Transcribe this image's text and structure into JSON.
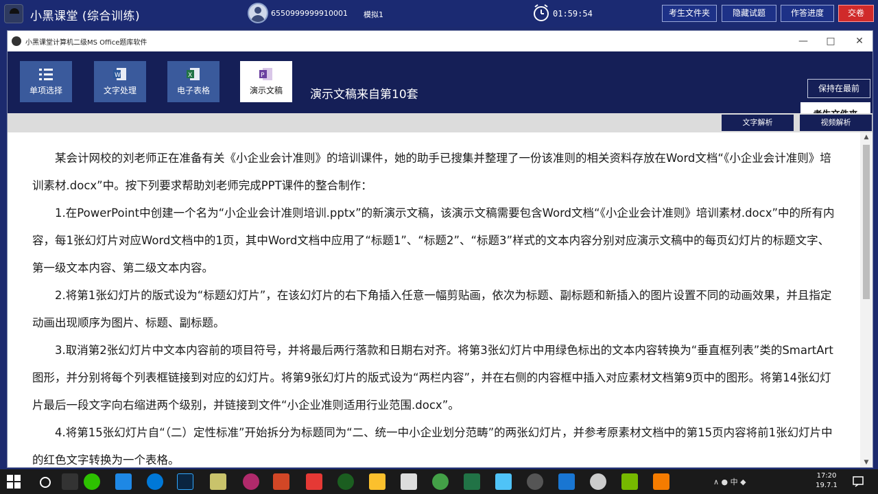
{
  "outer": {
    "app_title": "小黑课堂 (综合训练)",
    "user_id": "6550999999910001",
    "user_name": "模拟1",
    "timer": "01:59:54",
    "buttons": [
      "考生文件夹",
      "隐藏试题",
      "作答进度",
      "交卷"
    ]
  },
  "dialog": {
    "title": "小黑课堂计算机二级MS Office题库软件",
    "window_controls": [
      "—",
      "□",
      "✕"
    ],
    "tools": [
      {
        "label": "单项选择",
        "icon": "list-icon"
      },
      {
        "label": "文字处理",
        "icon": "word-icon"
      },
      {
        "label": "电子表格",
        "icon": "excel-icon"
      },
      {
        "label": "演示文稿",
        "icon": "powerpoint-icon"
      }
    ],
    "source": "演示文稿来自第10套",
    "keep_front": "保持在最前",
    "exam_folder": "考生文件夹",
    "sub_buttons": [
      "文字解析",
      "视频解析"
    ]
  },
  "content": {
    "paragraphs": [
      "某会计网校的刘老师正在准备有关《小企业会计准则》的培训课件，她的助手已搜集并整理了一份该准则的相关资料存放在Word文档“《小企业会计准则》培训素材.docx”中。按下列要求帮助刘老师完成PPT课件的整合制作：",
      "1.在PowerPoint中创建一个名为“小企业会计准则培训.pptx”的新演示文稿，该演示文稿需要包含Word文档“《小企业会计准则》培训素材.docx”中的所有内容，每1张幻灯片对应Word文档中的1页，其中Word文档中应用了“标题1”、“标题2”、“标题3”样式的文本内容分别对应演示文稿中的每页幻灯片的标题文字、第一级文本内容、第二级文本内容。",
      "2.将第1张幻灯片的版式设为“标题幻灯片”，在该幻灯片的右下角插入任意一幅剪贴画，依次为标题、副标题和新插入的图片设置不同的动画效果，并且指定动画出现顺序为图片、标题、副标题。",
      "3.取消第2张幻灯片中文本内容前的项目符号，并将最后两行落款和日期右对齐。将第3张幻灯片中用绿色标出的文本内容转换为“垂直框列表”类的SmartArt图形，并分别将每个列表框链接到对应的幻灯片。将第9张幻灯片的版式设为“两栏内容”，并在右侧的内容框中插入对应素材文档第9页中的图形。将第14张幻灯片最后一段文字向右缩进两个级别，并链接到文件“小企业准则适用行业范围.docx”。",
      "4.将第15张幻灯片自“（二）定性标准”开始拆分为标题同为“二、统一中小企业划分范畴”的两张幻灯片，并参考原素材文档中的第15页内容将前1张幻灯片中的红色文字转换为一个表格。"
    ]
  },
  "taskbar": {
    "tray": "∧ ● 中 ◆",
    "time": "17:20",
    "date": "19.7.1"
  }
}
